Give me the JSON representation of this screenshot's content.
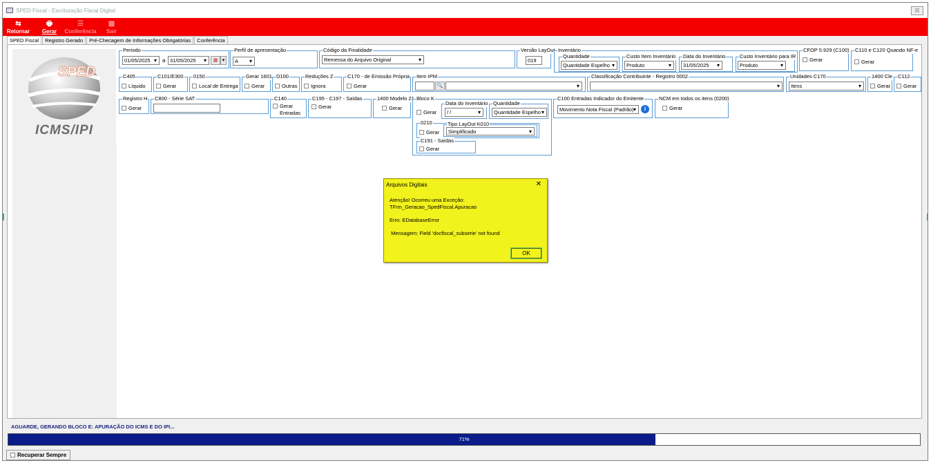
{
  "window": {
    "title": "SPED Fiscal - Escrituração Fiscal Digital",
    "close_label": "☒"
  },
  "toolbar": [
    {
      "label": "Retornar",
      "icon": "return-icon",
      "glyph": "⇆",
      "enabled": true
    },
    {
      "label": "Gerar",
      "icon": "print-icon",
      "glyph": "🖶",
      "enabled": true
    },
    {
      "label": "Conferência",
      "icon": "list-icon",
      "glyph": "☰",
      "enabled": false
    },
    {
      "label": "Sair",
      "icon": "exit-icon",
      "glyph": "▦",
      "enabled": false
    }
  ],
  "tabs": [
    "SPED Fiscal",
    "Registro Gerado",
    "Pré-Checagem de Informações Obrigatórias",
    "Conferência"
  ],
  "logo": {
    "sped_text": "SPED",
    "icms_text": "ICMS/IPI"
  },
  "fields": {
    "periodo": {
      "label": "Periodo",
      "from": "01/05/2025",
      "sep": "a",
      "to": "31/05/2025"
    },
    "perfil": {
      "label": "Perfil de apresentação",
      "value": "A"
    },
    "finalidade": {
      "label": "Código da Finalidade",
      "value": "Remessa do Arquivo Original"
    },
    "versao": {
      "label": "Versão LayOut",
      "value": "019"
    },
    "inventario": {
      "label": "Inventário",
      "quantidade_label": "Quantidade",
      "quantidade_value": "Quantidade Espelho",
      "custo_label": "Custo Item Inventário",
      "custo_value": "Produto",
      "data_label": "Data do Inventário",
      "data_value": "31/05/2025",
      "custo_ir_label": "Custo Inventário para IR",
      "custo_ir_value": "Produto"
    },
    "cfop": {
      "label": "CFOP 5.929 (C100)",
      "check": "Gerar"
    },
    "c110": {
      "label": "C110 e C120 Quando NF-e",
      "check": "Gerar"
    },
    "c405": {
      "label": "C405",
      "check": "Líquido"
    },
    "c101": {
      "label": "C101/E300",
      "check": "Gerar"
    },
    "r0150": {
      "label": "0150",
      "check": "Local de Entrega"
    },
    "gerar1601": {
      "label": "Gerar 1601",
      "check": "Gerar"
    },
    "d100": {
      "label": "D100",
      "check": "Outras"
    },
    "reducoes": {
      "label": "Reduções Z",
      "check": "Ignora"
    },
    "c170": {
      "label": "C170 - de Emissão Própria",
      "check": "Gerar"
    },
    "item_ipm": {
      "label": "Item IPM"
    },
    "classificacao": {
      "label": "Classificação Contribuinte - Registro 0002"
    },
    "unidades": {
      "label": "Unidades C170",
      "value": "Itens"
    },
    "r1400cle": {
      "label": "1400 Cle",
      "check": "Gerar"
    },
    "c112": {
      "label": "C112",
      "check": "Gerar"
    },
    "registro_h": {
      "label": "Registro H",
      "check": "Gerar"
    },
    "c800": {
      "label": "C800 - Série SAT"
    },
    "c140": {
      "label": "C140",
      "check1": "Gerar",
      "check2": "Entradas"
    },
    "c195": {
      "label": "C195 - C197 - Saídas",
      "check": "Gerar"
    },
    "r1400m21": {
      "label": "1400 Modelo 21",
      "check": "Gerar"
    },
    "bloco_k": {
      "label": "Bloco K",
      "check": "Gerar",
      "data_label": "Data do Inventário",
      "data_value": " / /",
      "qtd_label": "Quantidade",
      "qtd_value": "Quantidade Espelho"
    },
    "r0210": {
      "label": "0210",
      "check": "Gerar",
      "tipo_label": "Tipo LayOut K010",
      "tipo_value": "Simplificado"
    },
    "c191": {
      "label": "C191 - Saídas",
      "check": "Gerar"
    },
    "c100": {
      "label": "C100 Entradas Indicador do Emitente",
      "value": "Movimento Nota Fiscal (Padrão)"
    },
    "ncm": {
      "label": "NCM em todos os itens (0200)",
      "check": "Gerar"
    }
  },
  "dialog": {
    "title": "Arquivos Digitais",
    "close": "✕",
    "message": "Atenção! Ocorreu uma Exceção:\nTFrm_Geracao_SpedFiscal.Apuracao\n\nErro: EDatabaseError\n\n Mensagem: Field 'docfiscal_subserie' not found",
    "ok": "OK"
  },
  "status": {
    "message": "AGUARDE, GERANDO BLOCO E: APURAÇÃO DO ICMS E DO IPI...",
    "progress_text": "71%",
    "progress": 0.71
  },
  "bottom": {
    "label": "Recuperar Sempre"
  }
}
